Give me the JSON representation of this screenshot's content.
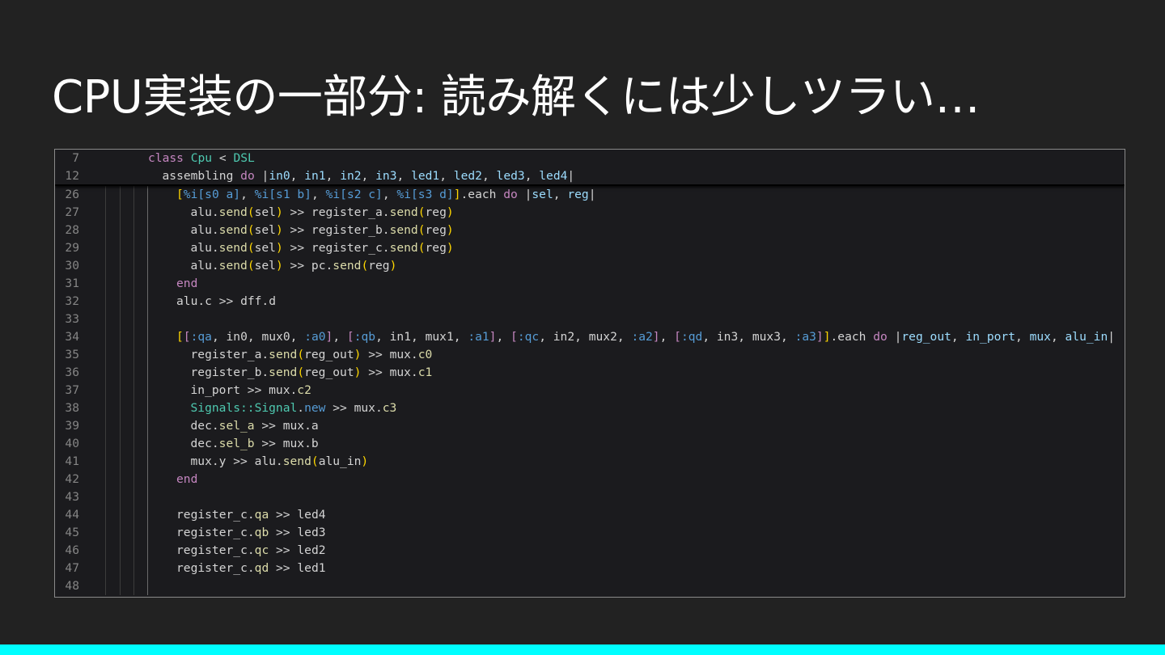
{
  "slide": {
    "title": "CPU実装の一部分: 読み解くには少しツラい…",
    "accent_bar_color": "#00ffff"
  },
  "editor": {
    "sticky_lines": [
      {
        "num": "7",
        "indent": 0,
        "tokens": [
          [
            "kw",
            "class"
          ],
          [
            "op",
            " "
          ],
          [
            "ty",
            "Cpu"
          ],
          [
            "op",
            " < "
          ],
          [
            "ty",
            "DSL"
          ]
        ]
      },
      {
        "num": "12",
        "indent": 1,
        "tokens": [
          [
            "op",
            "assembling "
          ],
          [
            "kw",
            "do"
          ],
          [
            "op",
            " |"
          ],
          [
            "va",
            "in0"
          ],
          [
            "op",
            ", "
          ],
          [
            "va",
            "in1"
          ],
          [
            "op",
            ", "
          ],
          [
            "va",
            "in2"
          ],
          [
            "op",
            ", "
          ],
          [
            "va",
            "in3"
          ],
          [
            "op",
            ", "
          ],
          [
            "va",
            "led1"
          ],
          [
            "op",
            ", "
          ],
          [
            "va",
            "led2"
          ],
          [
            "op",
            ", "
          ],
          [
            "va",
            "led3"
          ],
          [
            "op",
            ", "
          ],
          [
            "va",
            "led4"
          ],
          [
            "op",
            "|"
          ]
        ]
      }
    ],
    "lines": [
      {
        "num": "26",
        "indent": 2,
        "tokens": [
          [
            "br",
            "["
          ],
          [
            "sy",
            "%i"
          ],
          [
            "sy",
            "[s0 a]"
          ],
          [
            "op",
            ", "
          ],
          [
            "sy",
            "%i"
          ],
          [
            "sy",
            "[s1 b]"
          ],
          [
            "op",
            ", "
          ],
          [
            "sy",
            "%i"
          ],
          [
            "sy",
            "[s2 c]"
          ],
          [
            "op",
            ", "
          ],
          [
            "sy",
            "%i"
          ],
          [
            "sy",
            "[s3 d]"
          ],
          [
            "br",
            "]"
          ],
          [
            "op",
            ".each "
          ],
          [
            "kw",
            "do"
          ],
          [
            "op",
            " |"
          ],
          [
            "va",
            "sel"
          ],
          [
            "op",
            ", "
          ],
          [
            "va",
            "reg"
          ],
          [
            "op",
            "|"
          ]
        ]
      },
      {
        "num": "27",
        "indent": 3,
        "tokens": [
          [
            "op",
            "alu."
          ],
          [
            "fn",
            "send"
          ],
          [
            "br",
            "("
          ],
          [
            "op",
            "sel"
          ],
          [
            "br",
            ")"
          ],
          [
            "op",
            " >> register_a."
          ],
          [
            "fn",
            "send"
          ],
          [
            "br",
            "("
          ],
          [
            "op",
            "reg"
          ],
          [
            "br",
            ")"
          ]
        ]
      },
      {
        "num": "28",
        "indent": 3,
        "tokens": [
          [
            "op",
            "alu."
          ],
          [
            "fn",
            "send"
          ],
          [
            "br",
            "("
          ],
          [
            "op",
            "sel"
          ],
          [
            "br",
            ")"
          ],
          [
            "op",
            " >> register_b."
          ],
          [
            "fn",
            "send"
          ],
          [
            "br",
            "("
          ],
          [
            "op",
            "reg"
          ],
          [
            "br",
            ")"
          ]
        ]
      },
      {
        "num": "29",
        "indent": 3,
        "tokens": [
          [
            "op",
            "alu."
          ],
          [
            "fn",
            "send"
          ],
          [
            "br",
            "("
          ],
          [
            "op",
            "sel"
          ],
          [
            "br",
            ")"
          ],
          [
            "op",
            " >> register_c."
          ],
          [
            "fn",
            "send"
          ],
          [
            "br",
            "("
          ],
          [
            "op",
            "reg"
          ],
          [
            "br",
            ")"
          ]
        ]
      },
      {
        "num": "30",
        "indent": 3,
        "tokens": [
          [
            "op",
            "alu."
          ],
          [
            "fn",
            "send"
          ],
          [
            "br",
            "("
          ],
          [
            "op",
            "sel"
          ],
          [
            "br",
            ")"
          ],
          [
            "op",
            " >> pc."
          ],
          [
            "fn",
            "send"
          ],
          [
            "br",
            "("
          ],
          [
            "op",
            "reg"
          ],
          [
            "br",
            ")"
          ]
        ]
      },
      {
        "num": "31",
        "indent": 2,
        "tokens": [
          [
            "kw",
            "end"
          ]
        ]
      },
      {
        "num": "32",
        "indent": 2,
        "tokens": [
          [
            "op",
            "alu.c >> dff.d"
          ]
        ]
      },
      {
        "num": "33",
        "indent": 2,
        "tokens": []
      },
      {
        "num": "34",
        "indent": 2,
        "tokens": [
          [
            "br",
            "["
          ],
          [
            "kw",
            "["
          ],
          [
            "sy",
            ":qa"
          ],
          [
            "op",
            ", in0, mux0, "
          ],
          [
            "sy",
            ":a0"
          ],
          [
            "kw",
            "]"
          ],
          [
            "op",
            ", "
          ],
          [
            "kw",
            "["
          ],
          [
            "sy",
            ":qb"
          ],
          [
            "op",
            ", in1, mux1, "
          ],
          [
            "sy",
            ":a1"
          ],
          [
            "kw",
            "]"
          ],
          [
            "op",
            ", "
          ],
          [
            "kw",
            "["
          ],
          [
            "sy",
            ":qc"
          ],
          [
            "op",
            ", in2, mux2, "
          ],
          [
            "sy",
            ":a2"
          ],
          [
            "kw",
            "]"
          ],
          [
            "op",
            ", "
          ],
          [
            "kw",
            "["
          ],
          [
            "sy",
            ":qd"
          ],
          [
            "op",
            ", in3, mux3, "
          ],
          [
            "sy",
            ":a3"
          ],
          [
            "kw",
            "]"
          ],
          [
            "br",
            "]"
          ],
          [
            "op",
            ".each "
          ],
          [
            "kw",
            "do"
          ],
          [
            "op",
            " |"
          ],
          [
            "va",
            "reg_out"
          ],
          [
            "op",
            ", "
          ],
          [
            "va",
            "in_port"
          ],
          [
            "op",
            ", "
          ],
          [
            "va",
            "mux"
          ],
          [
            "op",
            ", "
          ],
          [
            "va",
            "alu_in"
          ],
          [
            "op",
            "|"
          ]
        ]
      },
      {
        "num": "35",
        "indent": 3,
        "tokens": [
          [
            "op",
            "register_a."
          ],
          [
            "fn",
            "send"
          ],
          [
            "br",
            "("
          ],
          [
            "op",
            "reg_out"
          ],
          [
            "br",
            ")"
          ],
          [
            "op",
            " >> mux."
          ],
          [
            "fn",
            "c0"
          ]
        ]
      },
      {
        "num": "36",
        "indent": 3,
        "tokens": [
          [
            "op",
            "register_b."
          ],
          [
            "fn",
            "send"
          ],
          [
            "br",
            "("
          ],
          [
            "op",
            "reg_out"
          ],
          [
            "br",
            ")"
          ],
          [
            "op",
            " >> mux."
          ],
          [
            "fn",
            "c1"
          ]
        ]
      },
      {
        "num": "37",
        "indent": 3,
        "tokens": [
          [
            "op",
            "in_port >> mux."
          ],
          [
            "fn",
            "c2"
          ]
        ]
      },
      {
        "num": "38",
        "indent": 3,
        "tokens": [
          [
            "ty",
            "Signals::Signal"
          ],
          [
            "op",
            "."
          ],
          [
            "sy",
            "new"
          ],
          [
            "op",
            " >> mux."
          ],
          [
            "fn",
            "c3"
          ]
        ]
      },
      {
        "num": "39",
        "indent": 3,
        "tokens": [
          [
            "op",
            "dec."
          ],
          [
            "fn",
            "sel_a"
          ],
          [
            "op",
            " >> mux.a"
          ]
        ]
      },
      {
        "num": "40",
        "indent": 3,
        "tokens": [
          [
            "op",
            "dec."
          ],
          [
            "fn",
            "sel_b"
          ],
          [
            "op",
            " >> mux.b"
          ]
        ]
      },
      {
        "num": "41",
        "indent": 3,
        "tokens": [
          [
            "op",
            "mux.y >> alu."
          ],
          [
            "fn",
            "send"
          ],
          [
            "br",
            "("
          ],
          [
            "op",
            "alu_in"
          ],
          [
            "br",
            ")"
          ]
        ]
      },
      {
        "num": "42",
        "indent": 2,
        "tokens": [
          [
            "kw",
            "end"
          ]
        ]
      },
      {
        "num": "43",
        "indent": 2,
        "tokens": []
      },
      {
        "num": "44",
        "indent": 2,
        "tokens": [
          [
            "op",
            "register_c."
          ],
          [
            "fn",
            "qa"
          ],
          [
            "op",
            " >> led4"
          ]
        ]
      },
      {
        "num": "45",
        "indent": 2,
        "tokens": [
          [
            "op",
            "register_c."
          ],
          [
            "fn",
            "qb"
          ],
          [
            "op",
            " >> led3"
          ]
        ]
      },
      {
        "num": "46",
        "indent": 2,
        "tokens": [
          [
            "op",
            "register_c."
          ],
          [
            "fn",
            "qc"
          ],
          [
            "op",
            " >> led2"
          ]
        ]
      },
      {
        "num": "47",
        "indent": 2,
        "tokens": [
          [
            "op",
            "register_c."
          ],
          [
            "fn",
            "qd"
          ],
          [
            "op",
            " >> led1"
          ]
        ]
      },
      {
        "num": "48",
        "indent": 2,
        "tokens": []
      }
    ]
  }
}
